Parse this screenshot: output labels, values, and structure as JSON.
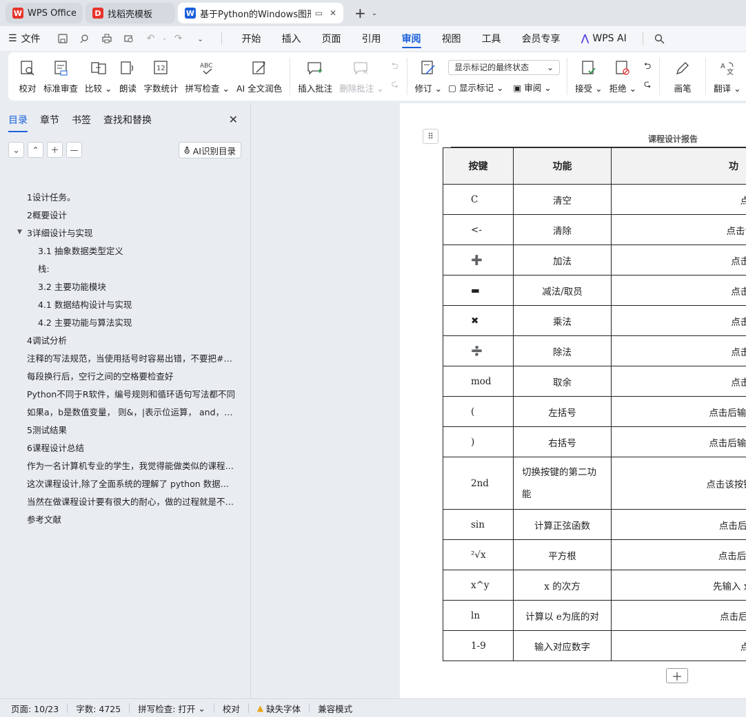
{
  "tabs": [
    {
      "label": "WPS Office",
      "logo": "W",
      "color": "#e8342b"
    },
    {
      "label": "找稻壳模板",
      "logo": "D",
      "color": "#e8342b"
    },
    {
      "label": "基于Python的Windows图形",
      "logo": "W",
      "color": "#1a5fdc"
    }
  ],
  "menubar": {
    "file_label": "文件",
    "items": [
      "开始",
      "插入",
      "页面",
      "引用",
      "审阅",
      "视图",
      "工具",
      "会员专享",
      "WPS AI"
    ]
  },
  "ribbon": {
    "proofread": "校对",
    "std_review": "标准审查",
    "compare": "比较",
    "read_aloud": "朗读",
    "word_count": "字数统计",
    "spell_check": "拼写检查",
    "ai_polish": "AI 全文润色",
    "insert_comment": "插入批注",
    "delete_comment": "删除批注",
    "revise": "修订",
    "markup_select": "显示标记的最终状态",
    "show_markup": "显示标记",
    "review": "审阅",
    "accept": "接受",
    "reject": "拒绝",
    "pen": "画笔",
    "translate": "翻译"
  },
  "nav": {
    "tabs": [
      "目录",
      "章节",
      "书签",
      "查找和替换"
    ],
    "ai_toc_label": "AI识别目录",
    "toc": [
      {
        "text": "1设计任务。",
        "level": 1
      },
      {
        "text": "2概要设计",
        "level": 1
      },
      {
        "text": "3详细设计与实现",
        "level": 1,
        "expanded": true
      },
      {
        "text": "3.1 抽象数据类型定义",
        "level": 2
      },
      {
        "text": "栈:",
        "level": 2
      },
      {
        "text": "3.2  主要功能模块",
        "level": 2
      },
      {
        "text": "4.1  数据结构设计与实现",
        "level": 2
      },
      {
        "text": "4.2  主要功能与算法实现",
        "level": 2
      },
      {
        "text": "4调试分析",
        "level": 1
      },
      {
        "text": "注释的写法规范，当使用括号时容易出错，不要把#放在括号里",
        "level": 1
      },
      {
        "text": "每段换行后，空行之间的空格要检查好",
        "level": 1
      },
      {
        "text": "Python不同于R软件，编号规则和循环语句写法都不同",
        "level": 1
      },
      {
        "text": "如果a，b是数值变量，  则&，|表示位运算，  and，or表示逻辑运算",
        "level": 1
      },
      {
        "text": "5测试结果",
        "level": 1
      },
      {
        "text": "6课程设计总结",
        "level": 1
      },
      {
        "text": "作为一名计算机专业的学生，我觉得能做类似的课程设计是十分有意义的",
        "level": 1
      },
      {
        "text": "这次课程设计,除了全面系统的理解了 python 数据结构的基本知识",
        "level": 1
      },
      {
        "text": "当然在做课程设计要有很大的耐心，做的过程就是不断发现问题的过程",
        "level": 1
      },
      {
        "text": "参考文献",
        "level": 1
      }
    ]
  },
  "document": {
    "header": "课程设计报告",
    "table_headers": [
      "按键",
      "功能",
      "功"
    ],
    "rows": [
      {
        "key": "C",
        "func": "清空",
        "desc": "点击该"
      },
      {
        "key": "<-",
        "func": "清除",
        "desc": "点击该键清除"
      },
      {
        "key": "➕",
        "func": "加法",
        "desc": "点击后输入"
      },
      {
        "key": "▬",
        "func": "减法/取员",
        "desc": "点击后输入"
      },
      {
        "key": "✖",
        "func": "乘法",
        "desc": "点击后输入"
      },
      {
        "key": "➗",
        "func": "除法",
        "desc": "点击后输入"
      },
      {
        "key": "mod",
        "func": "取余",
        "desc": "点击后输入"
      },
      {
        "key": "(",
        "func": "左括号",
        "desc": "点击后输入”(”,用于混"
      },
      {
        "key": ")",
        "func": "右括号",
        "desc": "点击后输入”)”,用于混"
      },
      {
        "key": "2nd",
        "func": "切换按键的第二功能",
        "desc": "点击该按键，指数,对数",
        "tall": true
      },
      {
        "key": "sin",
        "func": "计算正弦函数",
        "desc": "点击后输入 sin()"
      },
      {
        "key": "²√x",
        "func": "平方根",
        "desc": "点击后输入 sqrt("
      },
      {
        "key": "x^y",
        "func": "x 的次方",
        "desc": "先输入 x，点击该键"
      },
      {
        "key": "ln",
        "func": "计算以 e为底的对",
        "desc": "点击后输入 ln(),"
      },
      {
        "key": "1-9",
        "func": "输入对应数字",
        "desc": "点击后"
      }
    ]
  },
  "status": {
    "page": "页面: 10/23",
    "words": "字数: 4725",
    "spell": "拼写检查: 打开",
    "proof": "校对",
    "missing_font": "缺失字体",
    "compat": "兼容模式"
  }
}
